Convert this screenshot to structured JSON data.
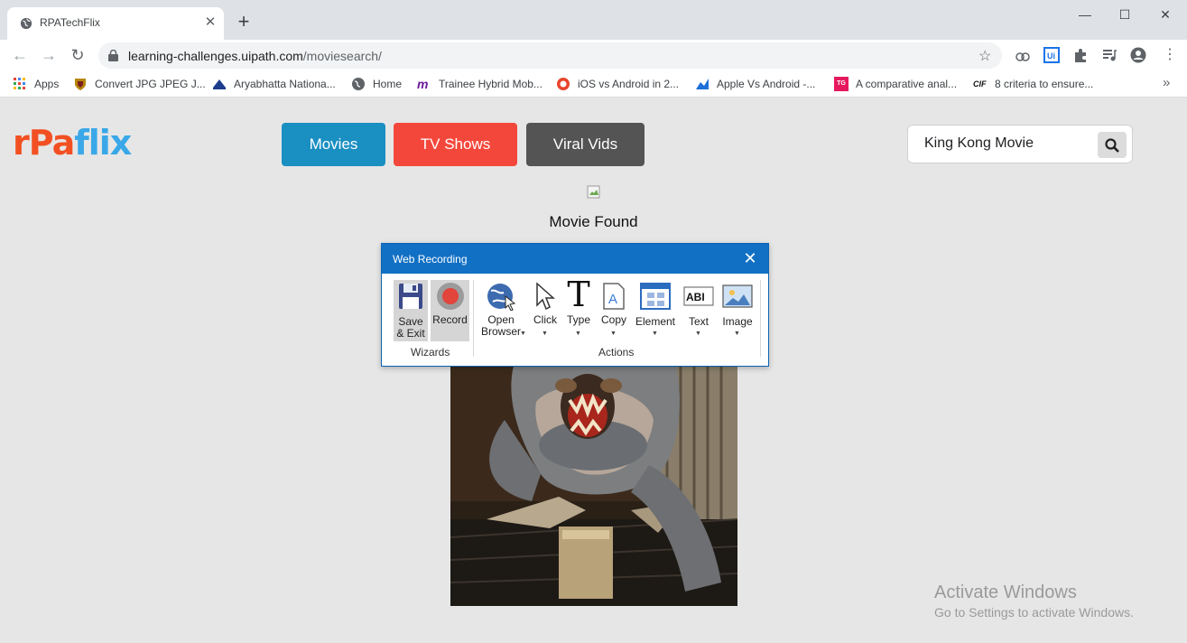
{
  "browser": {
    "tab_title": "RPATechFlix",
    "tab_close": "✕",
    "new_tab": "+",
    "url_host": "learning-challenges.uipath.com",
    "url_path": "/moviesearch/",
    "bookmarks": [
      {
        "label": "Apps"
      },
      {
        "label": "Convert JPG JPEG J..."
      },
      {
        "label": "Aryabhatta Nationa..."
      },
      {
        "label": "Home"
      },
      {
        "label": "Trainee Hybrid Mob..."
      },
      {
        "label": "iOS vs Android in 2..."
      },
      {
        "label": "Apple Vs Android -..."
      },
      {
        "label": "A comparative anal..."
      },
      {
        "label": "8 criteria to ensure..."
      }
    ],
    "bookmarks_more": "»"
  },
  "site": {
    "logo": {
      "part1": "rPa",
      "part2": "flix"
    },
    "nav": [
      {
        "label": "Movies",
        "color": "#1a8fc2"
      },
      {
        "label": "TV Shows",
        "color": "#f4473b"
      },
      {
        "label": "Viral Vids",
        "color": "#545454"
      }
    ],
    "search": {
      "value": "King Kong Movie"
    },
    "result_text": "Movie Found"
  },
  "dialog": {
    "title": "Web Recording",
    "close": "✕",
    "wizards": {
      "group_label": "Wizards",
      "save_l1": "Save",
      "save_l2": "& Exit",
      "record": "Record"
    },
    "actions": {
      "group_label": "Actions",
      "open_l1": "Open",
      "open_l2": "Browser",
      "click": "Click",
      "type": "Type",
      "copy": "Copy",
      "element": "Element",
      "text": "Text",
      "image": "Image"
    }
  },
  "watermark": {
    "line1": "Activate Windows",
    "line2": "Go to Settings to activate Windows."
  }
}
